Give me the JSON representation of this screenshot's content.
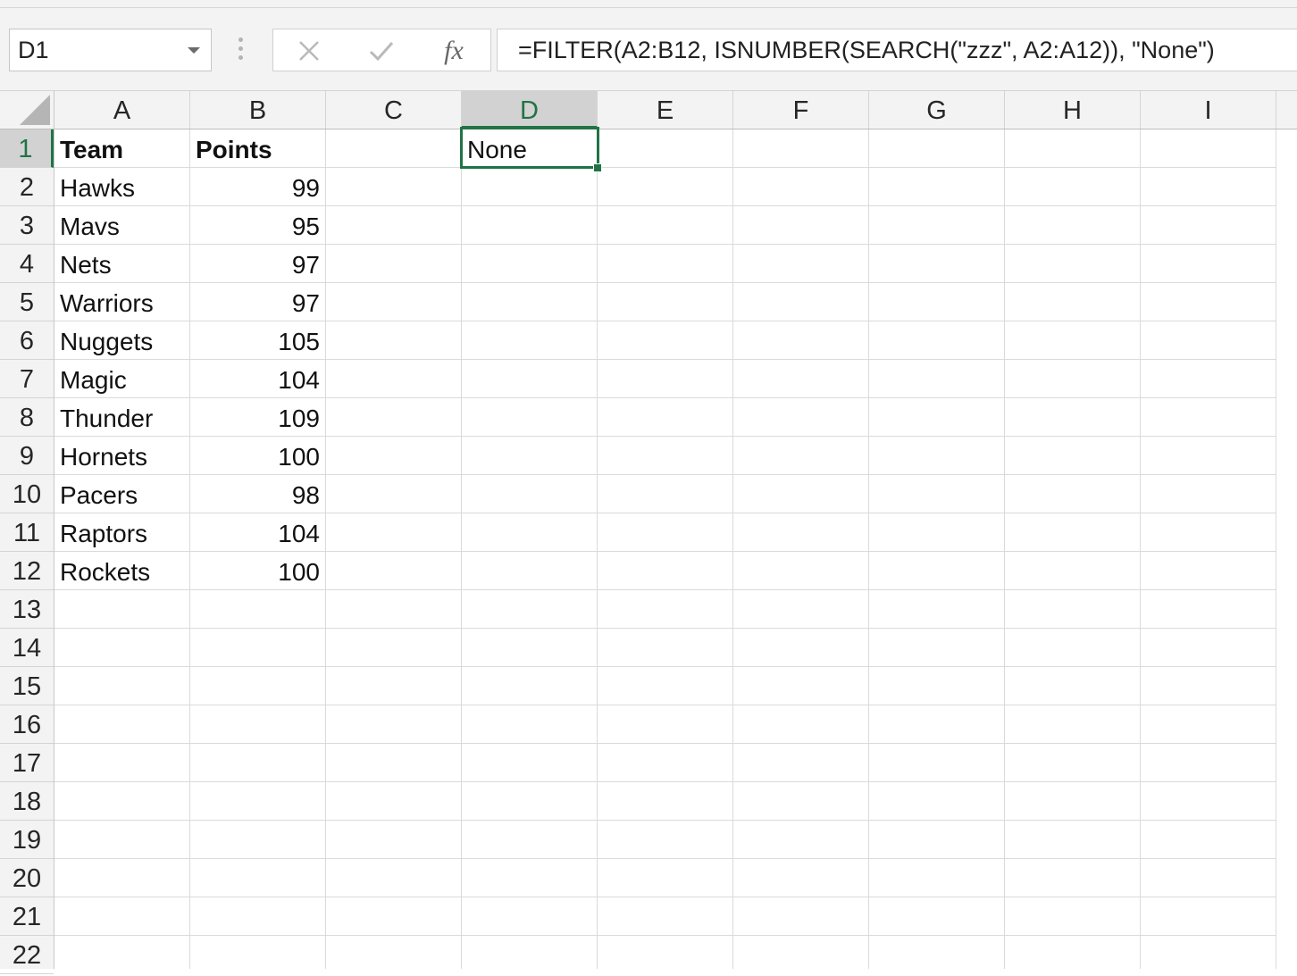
{
  "name_box": {
    "value": "D1"
  },
  "formula_bar": {
    "cancel_icon": "close-x-icon",
    "enter_icon": "checkmark-icon",
    "function_label": "fx",
    "formula": "=FILTER(A2:B12, ISNUMBER(SEARCH(\"zzz\", A2:A12)), \"None\")"
  },
  "columns": [
    "A",
    "B",
    "C",
    "D",
    "E",
    "F",
    "G",
    "H",
    "I"
  ],
  "selected_column": "D",
  "rows": [
    "1",
    "2",
    "3",
    "4",
    "5",
    "6",
    "7",
    "8",
    "9",
    "10",
    "11",
    "12",
    "13",
    "14",
    "15",
    "16",
    "17",
    "18",
    "19",
    "20",
    "21",
    "22"
  ],
  "selected_row": "1",
  "cells": {
    "A1": "Team",
    "B1": "Points",
    "D1": "None",
    "A2": "Hawks",
    "B2": "99",
    "A3": "Mavs",
    "B3": "95",
    "A4": "Nets",
    "B4": "97",
    "A5": "Warriors",
    "B5": "97",
    "A6": "Nuggets",
    "B6": "105",
    "A7": "Magic",
    "B7": "104",
    "A8": "Thunder",
    "B8": "109",
    "A9": "Hornets",
    "B9": "100",
    "A10": "Pacers",
    "B10": "98",
    "A11": "Raptors",
    "B11": "104",
    "A12": "Rockets",
    "B12": "100"
  },
  "bold_cells": [
    "A1",
    "B1"
  ],
  "numeric_cells": [
    "B2",
    "B3",
    "B4",
    "B5",
    "B6",
    "B7",
    "B8",
    "B9",
    "B10",
    "B11",
    "B12"
  ],
  "active_cell": "D1",
  "colors": {
    "accent": "#217346",
    "gridline": "#dadada",
    "header_bg": "#f3f3f3"
  }
}
